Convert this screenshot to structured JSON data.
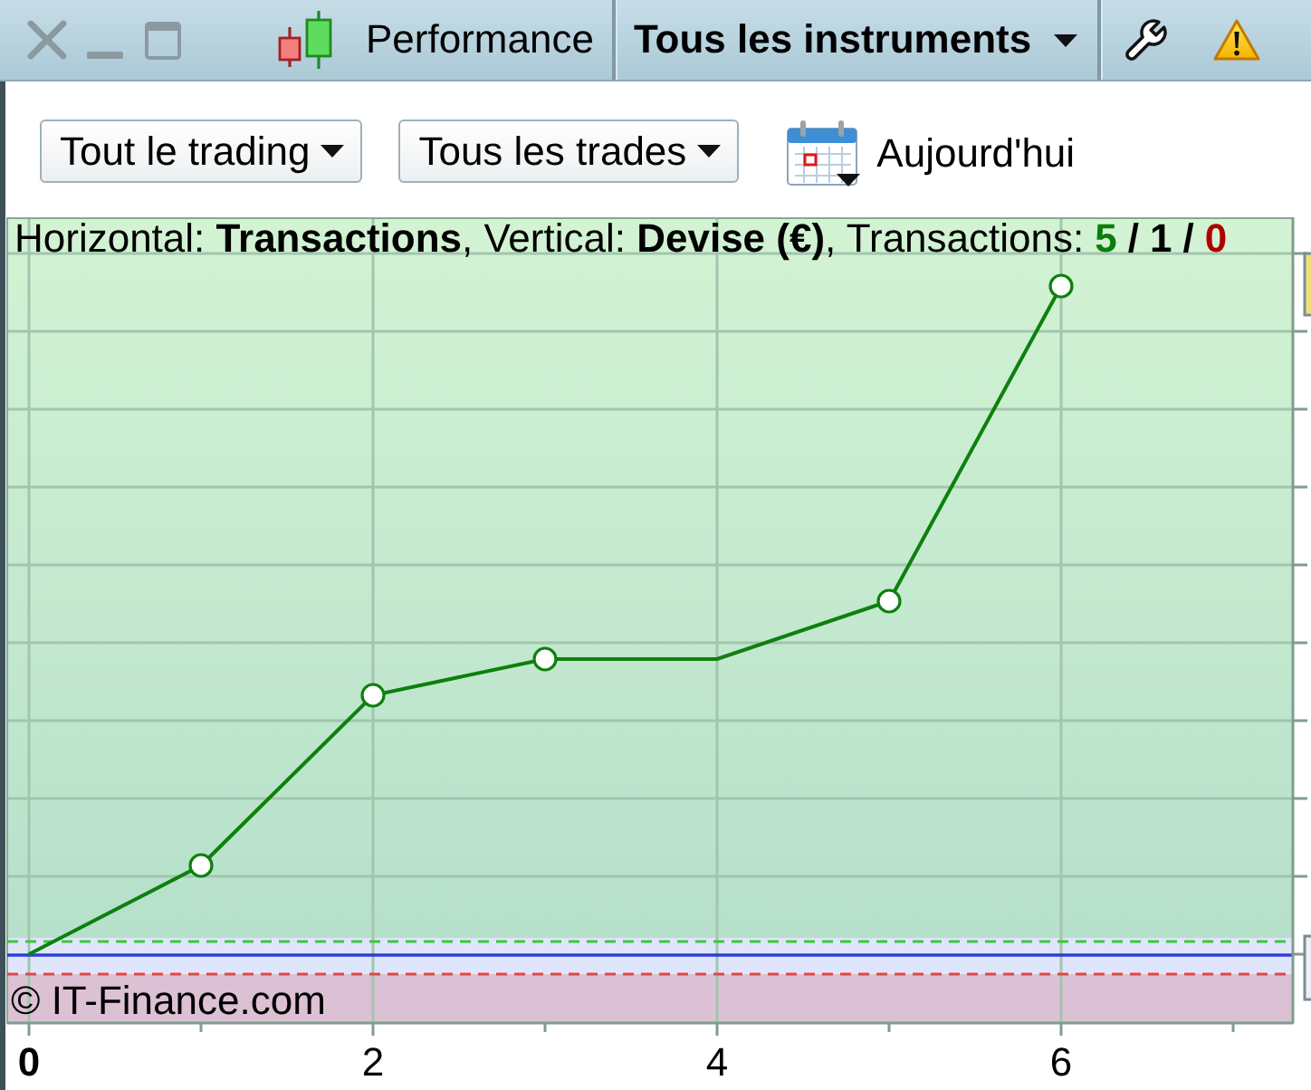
{
  "toolbar": {
    "title": "Performance",
    "instrument_menu": "Tous les instruments"
  },
  "filters": [
    "Tout le trading",
    "Tous les trades"
  ],
  "date_picker": {
    "label": "Aujourd'hui"
  },
  "chart": {
    "caption": "Horizontal: **Transactions**, Vertical: **Devise (€)**, Transactions:",
    "counts": [
      {
        "value": "5",
        "color": "#0b7d0b"
      },
      {
        "value": "1",
        "color": "#000000"
      },
      {
        "value": "0",
        "color": "#b00000"
      }
    ],
    "separators": [
      "/",
      "/"
    ],
    "x_ticks": [
      {
        "label": "0",
        "emphasized": true
      },
      {
        "label": "2",
        "emphasized": false
      },
      {
        "label": "4",
        "emphasized": false
      },
      {
        "label": "6",
        "emphasized": false
      }
    ],
    "copyright": "© IT-Finance.com"
  }
}
